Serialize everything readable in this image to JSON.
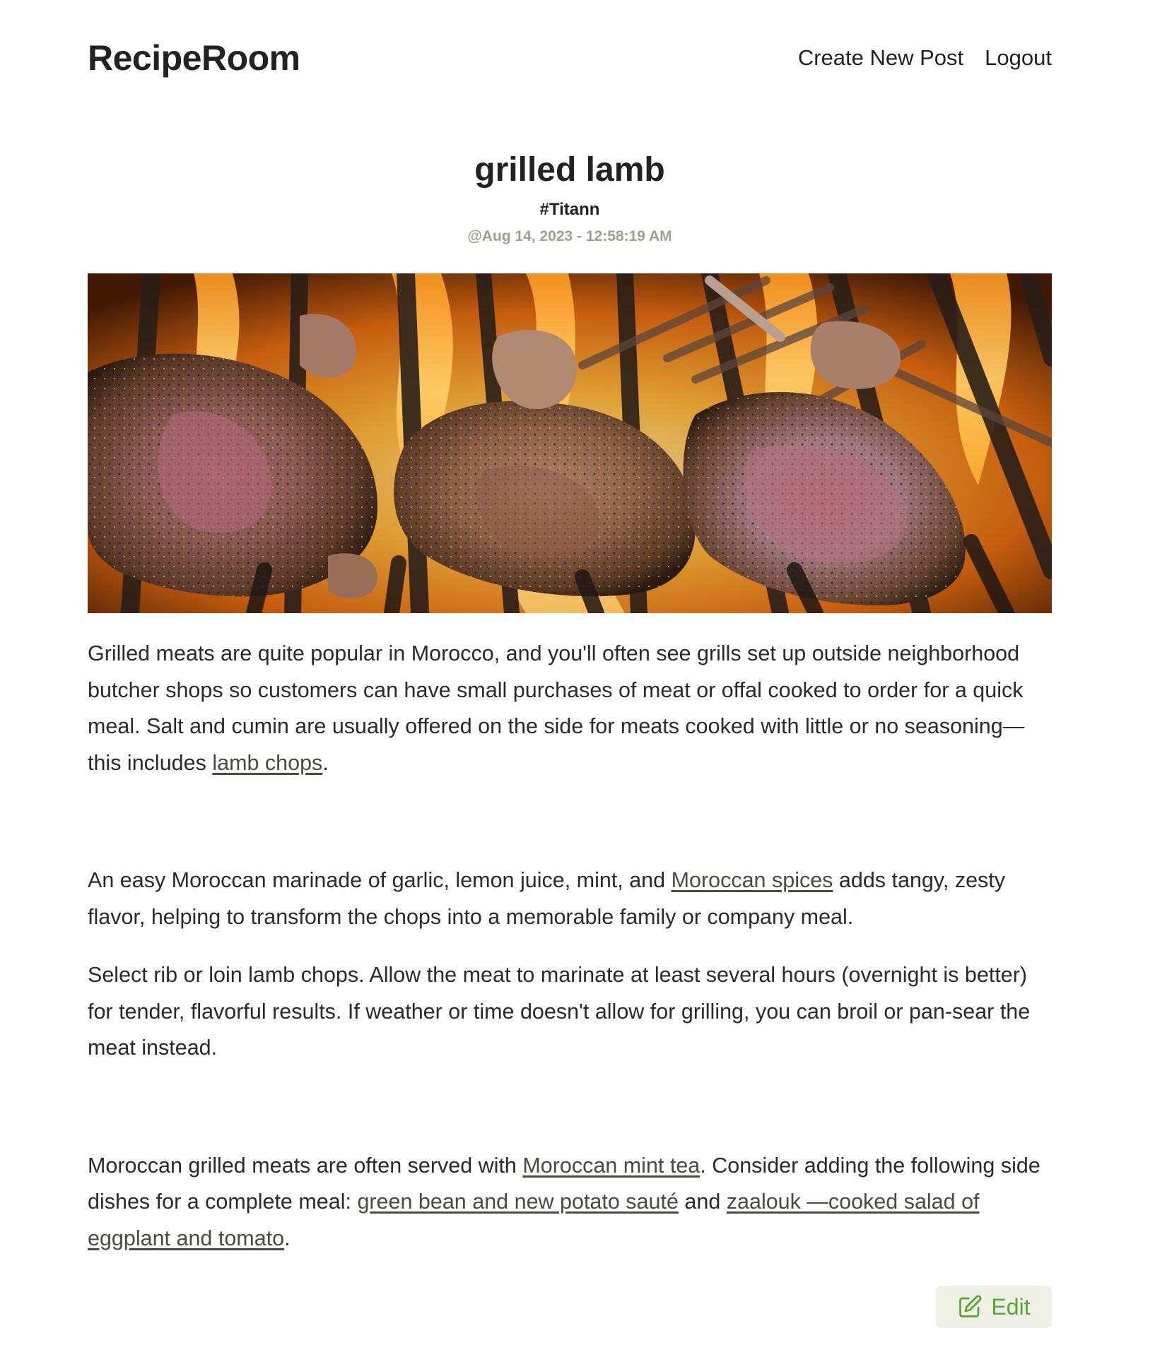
{
  "header": {
    "brand": "RecipeRoom",
    "nav": {
      "create_post": "Create New Post",
      "logout": "Logout"
    }
  },
  "post": {
    "title": "grilled lamb",
    "author": "#Titann",
    "date": "@Aug 14, 2023 - 12:58:19 AM",
    "image_alt": "grilled lamb chops on a flaming grill"
  },
  "body": {
    "p1": {
      "text": "Grilled meats are quite popular in Morocco, and you'll often see grills set up outside neighborhood butcher shops so customers can have small purchases of meat or offal cooked to order for a quick meal. Salt and cumin are usually offered on the side for meats cooked with little or no seasoning—this includes ",
      "link": "lamb chops",
      "tail": "."
    },
    "p2": {
      "text": "An easy Moroccan marinade of garlic, lemon juice, mint, and ",
      "link": "Moroccan spices",
      "tail": " adds tangy, zesty flavor, helping to transform the chops into a memorable family or company meal."
    },
    "p3": {
      "text": "Select rib or loin lamb chops. Allow the meat to marinate at least several hours (overnight is better) for tender, flavorful results. If weather or time doesn't allow for grilling, you can broil or pan-sear the meat instead."
    },
    "p4": {
      "text": "Moroccan grilled meats are often served with ",
      "link1": "Moroccan mint tea",
      "mid": ". Consider adding the following side dishes for a complete meal: ",
      "link2": "green bean and new potato sauté",
      "and": " and ",
      "link3": "zaalouk —cooked salad of eggplant and tomato",
      "tail": "."
    }
  },
  "actions": {
    "edit_label": "Edit",
    "edit_icon": "edit-pencil-icon",
    "edit_color": "#5aa332"
  }
}
